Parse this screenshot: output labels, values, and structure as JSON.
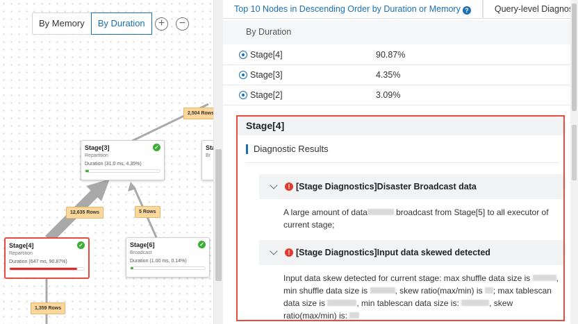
{
  "toolbar": {
    "by_memory": "By Memory",
    "by_duration": "By Duration",
    "zoom_in": "+",
    "zoom_out": "−"
  },
  "graph": {
    "nodes": [
      {
        "id": "stage3",
        "title": "Stage[3]",
        "sub": "Repartition",
        "duration": "Duration (31.0 ms, 4.35%)",
        "pct": 4.35,
        "bar_color": "#3cae35"
      },
      {
        "id": "stage4",
        "title": "Stage[4]",
        "sub": "Repartition",
        "duration": "Duration (647 ms, 90.87%)",
        "pct": 90.87,
        "bar_color": "#e02a2a"
      },
      {
        "id": "stage6",
        "title": "Stage[6]",
        "sub": "Broadcast",
        "duration": "Duration (1.00 ms, 0.14%)",
        "pct": 0.14,
        "bar_color": "#3cae35"
      },
      {
        "id": "stage-partial",
        "title": "Sta",
        "sub": "Br",
        "duration": "",
        "pct": 0,
        "bar_color": "#3cae35"
      }
    ],
    "edge_labels": [
      "2,504 Rows",
      "12,635 Rows",
      "5 Rows",
      "1,359 Rows"
    ]
  },
  "tabs": {
    "active": "Top 10 Nodes in Descending Order by Duration or Memory",
    "help": "?",
    "inactive": "Query-level Diagnosti"
  },
  "table": {
    "header": "By Duration",
    "rows": [
      {
        "stage": "Stage[4]",
        "value": "90.87%"
      },
      {
        "stage": "Stage[3]",
        "value": "4.35%"
      },
      {
        "stage": "Stage[2]",
        "value": "3.09%"
      }
    ]
  },
  "detail": {
    "title": "Stage[4]",
    "section": "Diagnostic Results",
    "issues": [
      {
        "icon": "!",
        "title": "[Stage Diagnostics]Disaster Broadcast data",
        "body_1": "A large amount of data",
        "body_2": " broadcast from Stage[5] to all executor of current stage;"
      },
      {
        "icon": "!",
        "title": "[Stage Diagnostics]Input data skewed detected",
        "p1": "Input data skew detected for current stage: max shuffle data size is ",
        "p2": ",",
        "p3": "min shuffle data size is ",
        "p4": ", skew ratio(max/min) is ",
        "p5": "; max tablescan",
        "p6": "data size is ",
        "p7": ", min tablescan data size is: ",
        "p8": ", skew",
        "p9": "ratio(max/min) is: "
      }
    ]
  }
}
